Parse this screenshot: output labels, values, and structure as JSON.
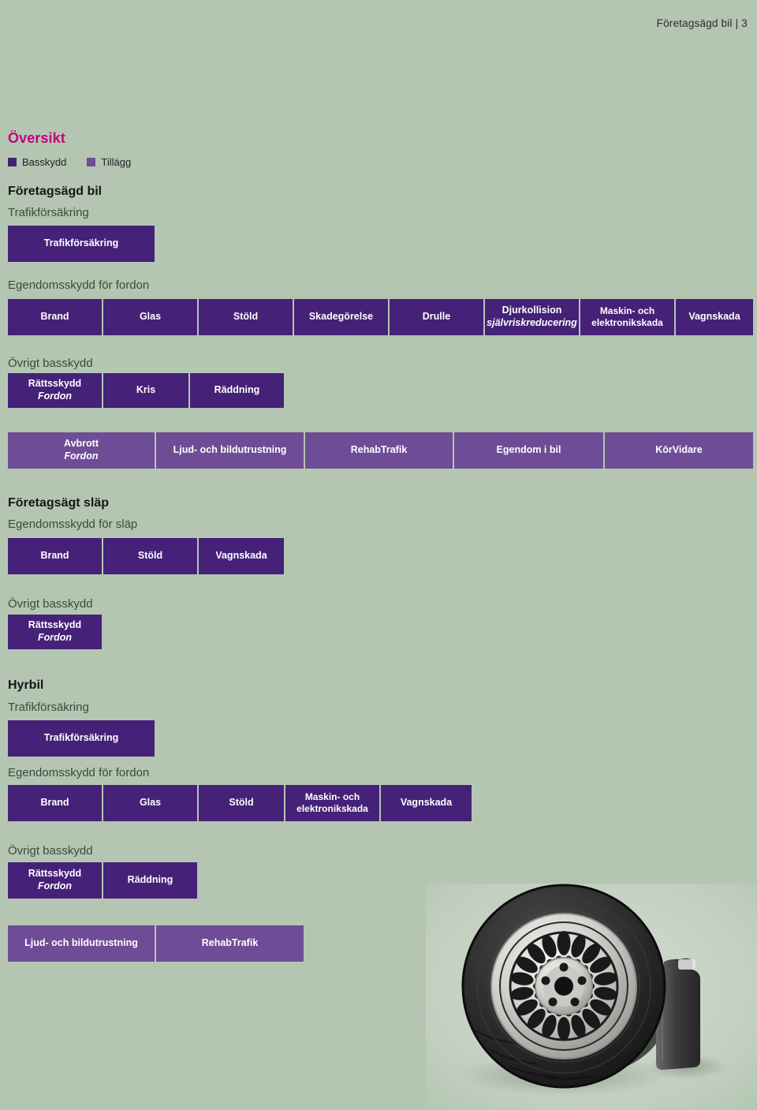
{
  "page": {
    "header_text": "Företagsägd bil | 3",
    "background_color": "#b4c6b2",
    "base_color": "#452178",
    "add_color": "#6f4c96",
    "accent_color": "#c4007a"
  },
  "overview": {
    "title": "Översikt",
    "legend": [
      {
        "label": "Basskydd",
        "color": "#452178"
      },
      {
        "label": "Tillägg",
        "color": "#6f4c96"
      }
    ]
  },
  "sections": {
    "company_car": {
      "title": "Företagsägd bil",
      "traffic": {
        "heading": "Trafikförsäkring",
        "boxes": [
          {
            "label": "Trafikförsäkring",
            "type": "base"
          }
        ]
      },
      "property": {
        "heading": "Egendomsskydd för fordon",
        "boxes": [
          {
            "label": "Brand",
            "type": "base"
          },
          {
            "label": "Glas",
            "type": "base"
          },
          {
            "label": "Stöld",
            "type": "base"
          },
          {
            "label": "Skadegörelse",
            "type": "base"
          },
          {
            "label": "Drulle",
            "type": "base"
          },
          {
            "label": "Djurkollision",
            "sub": "självriskreducering",
            "type": "base"
          },
          {
            "label": "Maskin- och elektronikskada",
            "type": "base"
          },
          {
            "label": "Vagnskada",
            "type": "base"
          }
        ]
      },
      "other": {
        "heading": "Övrigt basskydd",
        "boxes": [
          {
            "label": "Rättsskydd",
            "sub": "Fordon",
            "type": "base"
          },
          {
            "label": "Kris",
            "type": "base"
          },
          {
            "label": "Räddning",
            "type": "base"
          }
        ]
      },
      "addons": {
        "boxes": [
          {
            "label": "Avbrott",
            "sub": "Fordon",
            "type": "add"
          },
          {
            "label": "Ljud- och bildutrustning",
            "type": "add"
          },
          {
            "label": "RehabTrafik",
            "type": "add"
          },
          {
            "label": "Egendom i bil",
            "type": "add"
          },
          {
            "label": "KörVidare",
            "type": "add"
          }
        ]
      }
    },
    "company_trailer": {
      "title": "Företagsägt släp",
      "property": {
        "heading": "Egendomsskydd för släp",
        "boxes": [
          {
            "label": "Brand",
            "type": "base"
          },
          {
            "label": "Stöld",
            "type": "base"
          },
          {
            "label": "Vagnskada",
            "type": "base"
          }
        ]
      },
      "other": {
        "heading": "Övrigt basskydd",
        "boxes": [
          {
            "label": "Rättsskydd",
            "sub": "Fordon",
            "type": "base"
          }
        ]
      }
    },
    "rental_car": {
      "title": "Hyrbil",
      "traffic": {
        "heading": "Trafikförsäkring",
        "boxes": [
          {
            "label": "Trafikförsäkring",
            "type": "base"
          }
        ]
      },
      "property": {
        "heading": "Egendomsskydd för fordon",
        "boxes": [
          {
            "label": "Brand",
            "type": "base"
          },
          {
            "label": "Glas",
            "type": "base"
          },
          {
            "label": "Stöld",
            "type": "base"
          },
          {
            "label": "Maskin- och elektronikskada",
            "type": "base"
          },
          {
            "label": "Vagnskada",
            "type": "base"
          }
        ]
      },
      "other": {
        "heading": "Övrigt basskydd",
        "boxes": [
          {
            "label": "Rättsskydd",
            "sub": "Fordon",
            "type": "base"
          },
          {
            "label": "Räddning",
            "type": "base"
          }
        ]
      },
      "addons": {
        "boxes": [
          {
            "label": "Ljud- och bildutrustning",
            "type": "add"
          },
          {
            "label": "RehabTrafik",
            "type": "add"
          }
        ]
      }
    }
  },
  "illustration": {
    "name": "car-tire-and-oil-bottle-photo"
  }
}
